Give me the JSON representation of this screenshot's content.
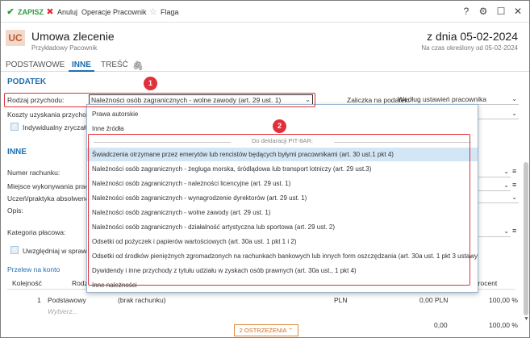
{
  "toolbar": {
    "save": "ZAPISZ",
    "cancel": "Anuluj",
    "operations": "Operacje",
    "worker": "Pracownik",
    "flag": "Flaga",
    "save_icon": "check-icon",
    "cancel_icon": "close-icon",
    "flag_icon": "star-icon",
    "help": "?",
    "settings": "gear-icon",
    "maximize": "window-icon",
    "close": "close-icon"
  },
  "header": {
    "badge": "UC",
    "title": "Umowa zlecenie",
    "subtitle": "Przykładowy Pacownik",
    "date": "z dnia 05-02-2024",
    "date_sub": "Na czas określony od 05-02-2024"
  },
  "tabs": [
    "PODSTAWOWE",
    "INNE",
    "TREŚĆ"
  ],
  "podatek": {
    "section": "PODATEK",
    "rodzaj_label": "Rodzaj przychodu:",
    "rodzaj_value": "Należności osób zagranicznych - wolne zawody (art. 29 ust. 1)",
    "koszty_label": "Koszty uzyskania przychodu",
    "indyw_label": "Indywidualny zryczałtow",
    "zaliczka_label": "Zaliczka na podatek:",
    "zaliczka_value": "Według ustawień pracownika"
  },
  "inne": {
    "section": "INNE",
    "numer_label": "Numer rachunku:",
    "miejsce_label": "Miejsce wykonywania pracy:",
    "uczen_label": "Uczeń/praktyka absolwencka",
    "opis_label": "Opis:",
    "kategoria_label": "Kategoria płacowa:",
    "uwzgl_label": "Uwzględniaj w sprawozd",
    "przelew_link": "Przelew na konto"
  },
  "dropdown": {
    "top_items": [
      "Prawa autorskie",
      "Inne źródła"
    ],
    "group_label": "Do deklaracji PIT-8AR:",
    "items": [
      "Świadczenia otrzymane przez emerytów lub rencistów będących byłymi pracownikami (art. 30 ust.1 pkt 4)",
      "Należności osób zagranicznych - żegluga morska, śródlądowa lub transport lotniczy (art. 29 ust.3)",
      "Należności osób zagranicznych - należności licencyjne (art. 29 ust. 1)",
      "Należności osób zagranicznych - wynagrodzenie dyrektorów (art. 29 ust. 1)",
      "Należności osób zagranicznych - wolne zawody (art. 29 ust. 1)",
      "Należności osób zagranicznych - działalność artystyczna lub sportowa (art. 29 ust. 2)",
      "Odsetki od pożyczek i papierów wartościowych (art. 30a ust. 1 pkt 1 i 2)",
      "Odsetki od środków pieniężnych zgromadzonych na rachunkach bankowych lub innych form oszczędzania (art. 30a ust. 1 pkt 3 ustawy)",
      "Dywidendy  i inne przychody z tytułu udziału w zyskach osób prawnych (art. 30a ust., 1 pkt 4)",
      "Inne należności"
    ],
    "highlighted_index": 0
  },
  "markers": [
    "1",
    "2"
  ],
  "table": {
    "headers": [
      "Kolejność",
      "Rodza",
      "Procent"
    ],
    "row": {
      "order": "1",
      "name": "Podstawowy",
      "account": "(brak rachunku)",
      "currency": "PLN",
      "amount": "0,00 PLN",
      "percent": "100,00 %"
    },
    "new_row_placeholder": "Wybierz...",
    "footer_amount": "0,00",
    "footer_percent": "100,00 %"
  },
  "warnings": "2 OSTRZEŻENIA",
  "colors": {
    "accent": "#1f6fb2",
    "highlight": "#e0303a",
    "save": "#2e9a3c"
  }
}
